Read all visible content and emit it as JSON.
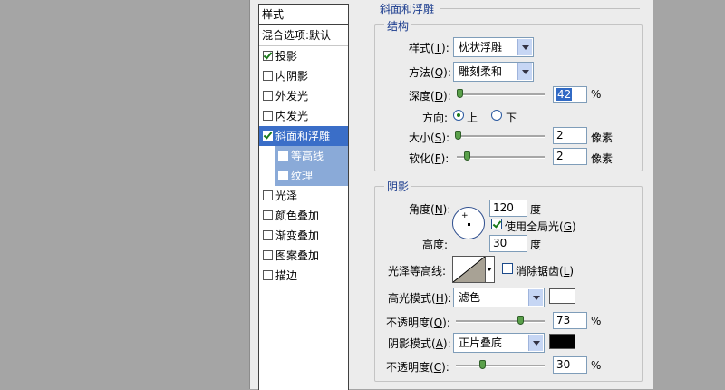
{
  "style_list": {
    "header": "样式",
    "blend_options": "混合选项:默认",
    "items": [
      {
        "label": "投影",
        "checked": true
      },
      {
        "label": "内阴影",
        "checked": false
      },
      {
        "label": "外发光",
        "checked": false
      },
      {
        "label": "内发光",
        "checked": false
      },
      {
        "label": "斜面和浮雕",
        "checked": true,
        "selected": true
      },
      {
        "label": "等高线",
        "checked": false,
        "child": true
      },
      {
        "label": "纹理",
        "checked": false,
        "child": true
      },
      {
        "label": "光泽",
        "checked": false
      },
      {
        "label": "颜色叠加",
        "checked": false
      },
      {
        "label": "渐变叠加",
        "checked": false
      },
      {
        "label": "图案叠加",
        "checked": false
      },
      {
        "label": "描边",
        "checked": false
      }
    ]
  },
  "panel": {
    "title": "斜面和浮雕",
    "structure": {
      "label": "结构",
      "style_label": "样式(",
      "style_key": "T",
      "style_value": "枕状浮雕",
      "technique_label": "方法(",
      "technique_key": "Q",
      "technique_value": "雕刻柔和",
      "depth_label": "深度(",
      "depth_key": "D",
      "depth_value": "42",
      "depth_unit": "%",
      "direction_label": "方向:",
      "direction_up": "上",
      "direction_down": "下",
      "size_label": "大小(",
      "size_key": "S",
      "size_value": "2",
      "size_unit": "像素",
      "soften_label": "软化(",
      "soften_key": "F",
      "soften_value": "2",
      "soften_unit": "像素",
      "close_paren": "):"
    },
    "shading": {
      "label": "阴影",
      "angle_label": "角度(",
      "angle_key": "N",
      "angle_value": "120",
      "angle_unit": "度",
      "global_light_label": "使用全局光(",
      "global_light_key": "G",
      "altitude_label": "高度:",
      "altitude_value": "30",
      "altitude_unit": "度",
      "gloss_contour_label": "光泽等高线:",
      "anti_alias_label": "消除锯齿(",
      "anti_alias_key": "L",
      "highlight_mode_label": "高光模式(",
      "highlight_mode_key": "H",
      "highlight_mode_value": "滤色",
      "highlight_color": "#ffffff",
      "highlight_opacity_label": "不透明度(",
      "highlight_opacity_key": "O",
      "highlight_opacity_value": "73",
      "shadow_mode_label": "阴影模式(",
      "shadow_mode_key": "A",
      "shadow_mode_value": "正片叠底",
      "shadow_color": "#000000",
      "shadow_opacity_label": "不透明度(",
      "shadow_opacity_key": "C",
      "shadow_opacity_value": "30",
      "percent": "%",
      "close_paren": "):",
      "close_paren_short": ")"
    }
  },
  "colors": {
    "selection": "#3a6ec8",
    "group_title": "#1b3c8e",
    "slider_thumb": "#5aa04a"
  }
}
